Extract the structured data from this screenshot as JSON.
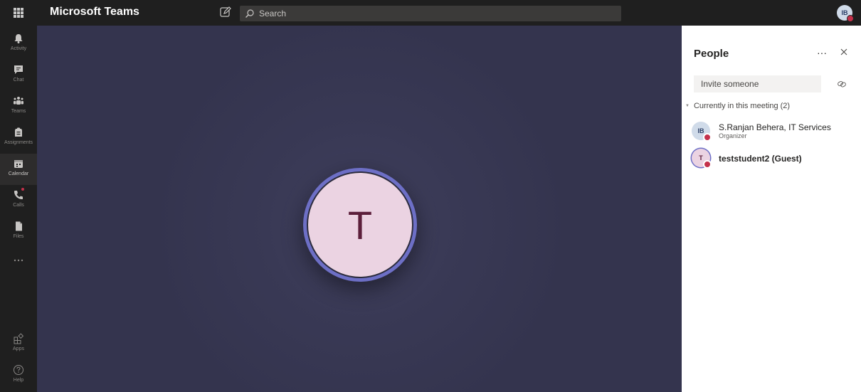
{
  "app": {
    "title": "Microsoft Teams",
    "search_placeholder": "Search",
    "user_initials": "IB"
  },
  "rail": {
    "items": [
      {
        "label": "Activity",
        "icon": "bell-icon"
      },
      {
        "label": "Chat",
        "icon": "chat-icon"
      },
      {
        "label": "Teams",
        "icon": "teams-icon"
      },
      {
        "label": "Assignments",
        "icon": "assignments-icon"
      },
      {
        "label": "Calendar",
        "icon": "calendar-icon",
        "active": true
      },
      {
        "label": "Calls",
        "icon": "phone-icon"
      },
      {
        "label": "Files",
        "icon": "files-icon"
      },
      {
        "label": "...",
        "icon": "more-icon"
      },
      {
        "label": "Apps",
        "icon": "apps-icon"
      },
      {
        "label": "Help",
        "icon": "help-icon"
      }
    ]
  },
  "stage": {
    "participant_initial": "T"
  },
  "panel": {
    "title": "People",
    "more": "···",
    "invite_placeholder": "Invite someone",
    "section_label": "Currently in this meeting (2)",
    "people": [
      {
        "initials": "IB",
        "name": "S.Ranjan Behera, IT Services",
        "role": "Organizer"
      },
      {
        "initials": "T",
        "name": "teststudent2 (Guest)",
        "role": ""
      }
    ]
  },
  "colors": {
    "accent": "#6d6fc6",
    "stage_bg": "#34344e",
    "status_busy": "#c4314b"
  }
}
